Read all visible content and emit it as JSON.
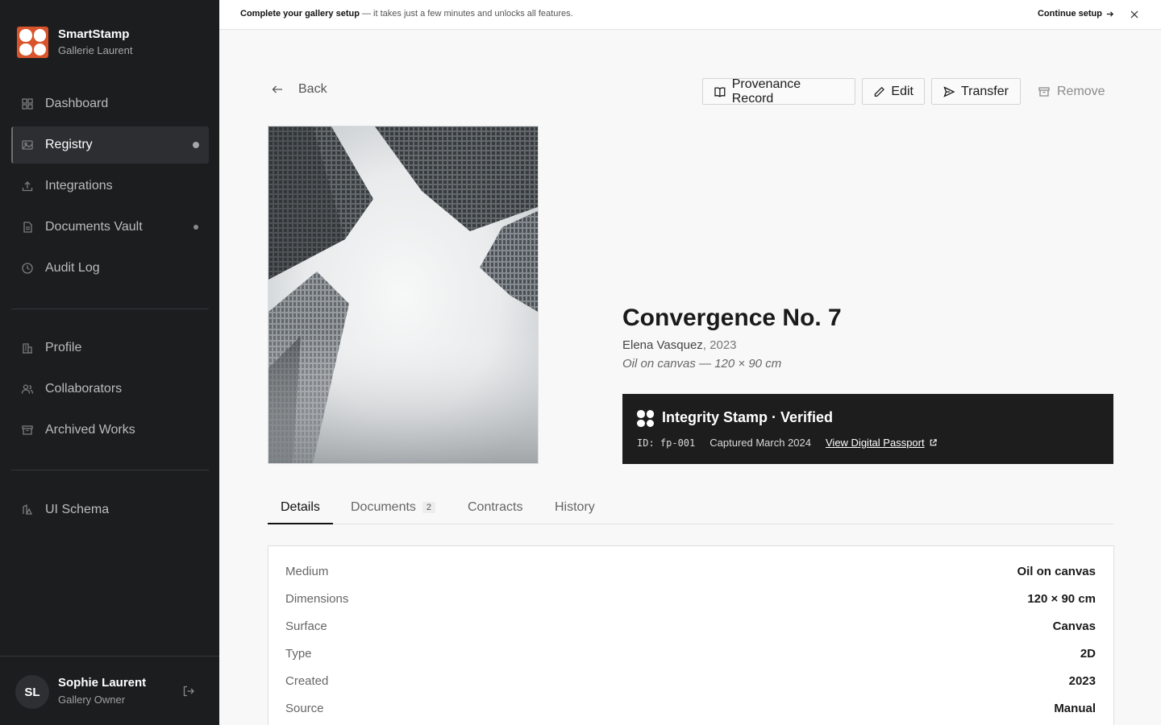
{
  "brand": {
    "name": "SmartStamp",
    "sub": "Gallerie Laurent"
  },
  "sidebar": {
    "items": [
      {
        "label": "Dashboard"
      },
      {
        "label": "Registry"
      },
      {
        "label": "Integrations"
      },
      {
        "label": "Documents Vault"
      },
      {
        "label": "Audit Log"
      },
      {
        "label": "Profile"
      },
      {
        "label": "Collaborators"
      },
      {
        "label": "Archived Works"
      },
      {
        "label": "UI Schema"
      }
    ]
  },
  "user": {
    "initials": "SL",
    "name": "Sophie Laurent",
    "role": "Gallery Owner"
  },
  "banner": {
    "bold": "Complete your gallery setup",
    "text": " — it takes just a few minutes and unlocks all features.",
    "cta": "Continue setup"
  },
  "toolbar": {
    "back": "Back",
    "provenance": "Provenance Record",
    "edit": "Edit",
    "transfer": "Transfer",
    "remove": "Remove"
  },
  "artwork": {
    "title": "Convergence No. 7",
    "artist": "Elena Vasquez",
    "year": ", 2023",
    "medium_line": "Oil on canvas — 120 × 90 cm"
  },
  "stamp": {
    "title": "Integrity Stamp · Verified",
    "id": "ID: fp-001",
    "captured": "Captured March 2024",
    "link": "View Digital Passport"
  },
  "tabs": [
    {
      "label": "Details"
    },
    {
      "label": "Documents",
      "count": "2"
    },
    {
      "label": "Contracts"
    },
    {
      "label": "History"
    }
  ],
  "details": [
    {
      "label": "Medium",
      "value": "Oil on canvas"
    },
    {
      "label": "Dimensions",
      "value": "120 × 90 cm"
    },
    {
      "label": "Surface",
      "value": "Canvas"
    },
    {
      "label": "Type",
      "value": "2D"
    },
    {
      "label": "Created",
      "value": "2023"
    },
    {
      "label": "Source",
      "value": "Manual"
    }
  ],
  "colors": {
    "brand": "#d9532b",
    "sidebar_bg": "#1c1d1f",
    "stamp_bg": "#1d1d1d"
  },
  "icons": {
    "dashboard": "grid-icon",
    "registry": "image-icon",
    "integrations": "upload-icon",
    "documents": "file-icon",
    "audit": "clock-icon",
    "profile": "building-icon",
    "collaborators": "users-icon",
    "archived": "archive-icon",
    "schema": "shapes-icon"
  }
}
